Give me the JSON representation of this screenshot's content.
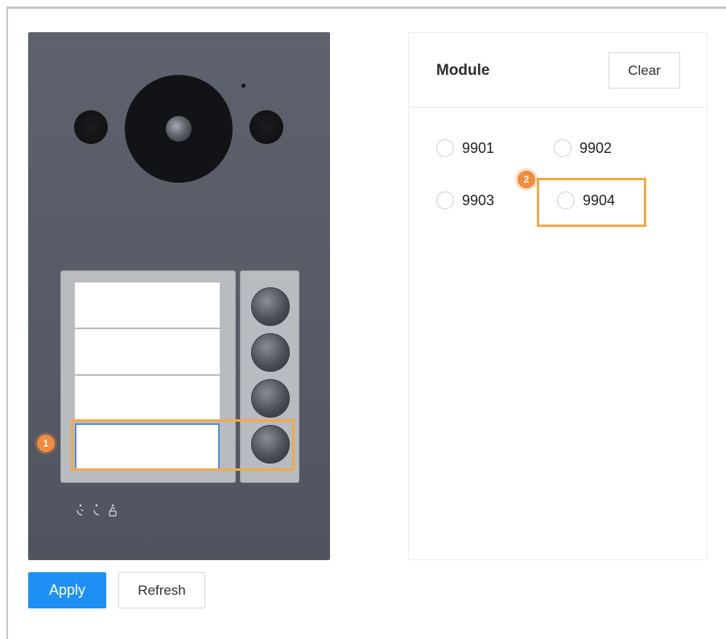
{
  "module": {
    "title": "Module",
    "clear_label": "Clear",
    "options": [
      {
        "label": "9901",
        "selected": false
      },
      {
        "label": "9902",
        "selected": false
      },
      {
        "label": "9903",
        "selected": false
      },
      {
        "label": "9904",
        "selected": false
      }
    ]
  },
  "callouts": {
    "one": "1",
    "two": "2"
  },
  "actions": {
    "apply_label": "Apply",
    "refresh_label": "Refresh"
  },
  "colors": {
    "accent": "#1e90f5",
    "callout": "#f08c3e",
    "highlight": "#f5a947",
    "device_body": "#5a5e69"
  }
}
